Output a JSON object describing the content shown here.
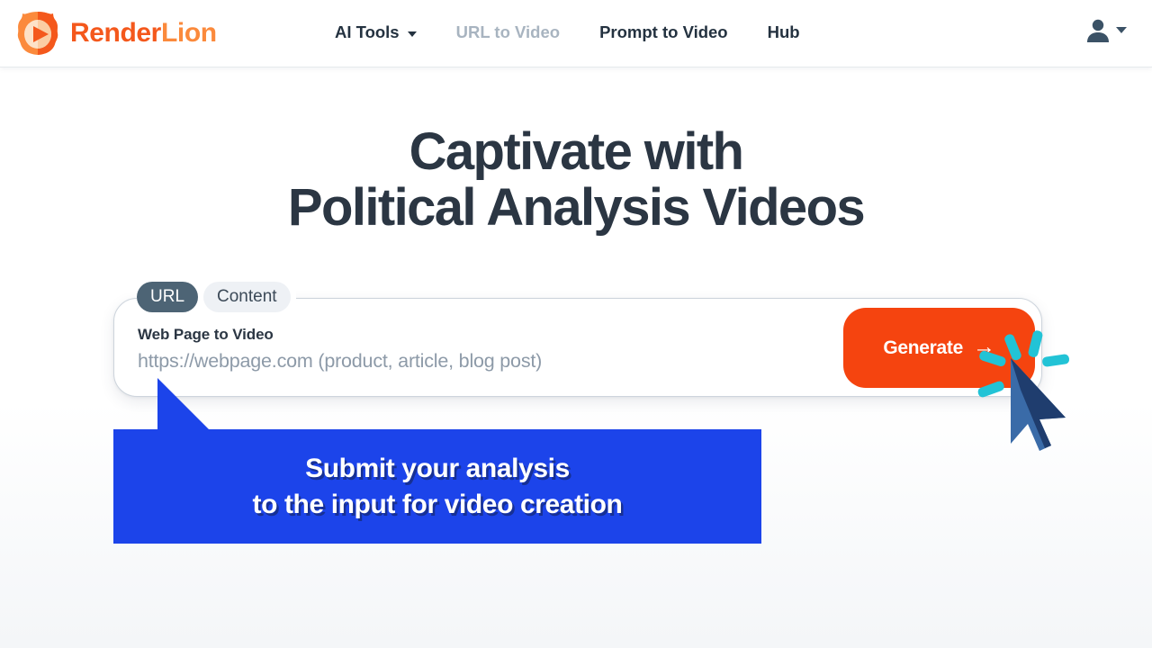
{
  "header": {
    "brand": {
      "logo_icon": "lion-play-logo-icon",
      "name_part1": "Render",
      "name_part2": "Lion"
    },
    "nav": [
      {
        "label": "AI Tools",
        "icon": "chevron-down-icon",
        "has_caret": true,
        "muted": false
      },
      {
        "label": "URL to Video",
        "has_caret": false,
        "muted": true
      },
      {
        "label": "Prompt to Video",
        "has_caret": false,
        "muted": false
      },
      {
        "label": "Hub",
        "has_caret": false,
        "muted": false
      }
    ],
    "account": {
      "icon": "user-avatar-icon",
      "caret_icon": "chevron-down-icon"
    }
  },
  "hero": {
    "heading_line1": "Captivate with",
    "heading_line2": "Political Analysis Videos"
  },
  "input_card": {
    "tabs": [
      {
        "label": "URL",
        "active": true
      },
      {
        "label": "Content",
        "active": false
      }
    ],
    "field_label": "Web Page to Video",
    "field_value": "",
    "field_placeholder": "https://webpage.com (product, article, blog post)",
    "generate_label": "Generate",
    "generate_arrow": "→"
  },
  "callout": {
    "line1": "Submit your analysis",
    "line2": "to the input for video creation"
  },
  "cursor": {
    "icon": "mouse-pointer-click-icon"
  },
  "colors": {
    "brand_orange_dark": "#f4581c",
    "brand_orange_light": "#fb8a3c",
    "generate_button": "#f5440f",
    "callout_blue": "#1c44ea",
    "heading_slate": "#2b3643",
    "tab_active": "#4d6475",
    "cursor_blue_light": "#3a6ba8",
    "cursor_blue_dark": "#1f3d6e",
    "click_ray_cyan": "#22c3d6"
  }
}
